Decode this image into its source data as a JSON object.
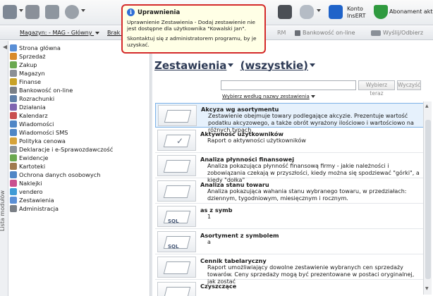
{
  "ribbon": {
    "konto_label": "Konto\nInsERT",
    "abonament_label": "Abonament aktyw"
  },
  "toolbar2": {
    "magazyn": "Magazyn: - MAG - Główny",
    "brak": "Brak b",
    "rm": "RM",
    "bankowosc": "Bankowość on-line",
    "wyslij": "Wyślij/Odbierz"
  },
  "tooltip": {
    "title": "Uprawnienia",
    "body": "Uprawnienie Zestawienia - Dodaj zestawienie nie jest dostępne dla użytkownika \"Kowalski Jan\".",
    "contact": "Skontaktuj się z administratorem programu, by je uzyskać."
  },
  "sidebar": {
    "tab_label": "Lista modułów",
    "items": [
      {
        "label": "Strona główna",
        "color": "#5a8fd6"
      },
      {
        "label": "Sprzedaż",
        "color": "#d98b2b"
      },
      {
        "label": "Zakup",
        "color": "#6aa84f"
      },
      {
        "label": "Magazyn",
        "color": "#8a8f96"
      },
      {
        "label": "Finanse",
        "color": "#c9a227"
      },
      {
        "label": "Bankowość on-line",
        "color": "#7a7f86"
      },
      {
        "label": "Rozrachunki",
        "color": "#5f7fa8"
      },
      {
        "label": "Działania",
        "color": "#7e64b0"
      },
      {
        "label": "Kalendarz",
        "color": "#c94f4f"
      },
      {
        "label": "Wiadomości",
        "color": "#4f86c6"
      },
      {
        "label": "Wiadomości SMS",
        "color": "#4f86c6"
      },
      {
        "label": "Polityka cenowa",
        "color": "#d6a33a"
      },
      {
        "label": "Deklaracje i e-Sprawozdawczość",
        "color": "#8b9299"
      },
      {
        "label": "Ewidencje",
        "color": "#6aa84f"
      },
      {
        "label": "Kartoteki",
        "color": "#a07a4f"
      },
      {
        "label": "Ochrona danych osobowych",
        "color": "#4f86c6"
      },
      {
        "label": "Naklejki",
        "color": "#c94f8f"
      },
      {
        "label": "vendero",
        "color": "#3f9bd6"
      },
      {
        "label": "Zestawienia",
        "color": "#5a8fd6"
      },
      {
        "label": "Administracja",
        "color": "#7a7f86"
      }
    ]
  },
  "main": {
    "title": "Zestawienia",
    "filter": "(wszystkie)",
    "search_value": "",
    "search_button": "Wybierz teraz",
    "clear_button": "Wyczyść",
    "sort_label": "Wybierz według nazwy zestawienia",
    "rows": [
      {
        "title": "Akcyza wg asortymentu",
        "desc": "Zestawienie obejmuje towary podlegające akcyzie. Prezentuje wartość podatku akcyzowego, a także obrót wyrażony ilościowo i wartościowo na różnych typach",
        "thumb": "card"
      },
      {
        "title": "Aktywność użytkowników",
        "desc": "Raport o aktywności użytkowników",
        "thumb": "check"
      },
      {
        "title": "Analiza płynności finansowej",
        "desc": "Analiza pokazująca płynność finansową firmy - jakie należności i zobowiązania czekają w przyszłości, kiedy można się spodziewać \"górki\", a kiedy \"dołka\"",
        "thumb": "card"
      },
      {
        "title": "Analiza stanu towaru",
        "desc": "Analiza pokazująca wahania stanu wybranego towaru, w przedziałach: dziennym, tygodniowym, miesięcznym i rocznym.",
        "thumb": "card"
      },
      {
        "title": "as z symb",
        "desc": "1",
        "thumb": "sql"
      },
      {
        "title": "Asortyment z symbolem",
        "desc": "a",
        "thumb": "sql"
      },
      {
        "title": "Cennik tabelaryczny",
        "desc": "Raport umożliwiający dowolne zestawienie wybranych cen sprzedaży towarów. Ceny sprzedaży mogą być prezentowane w postaci oryginalnej, jak zostać",
        "thumb": "card"
      },
      {
        "title": "Czyszczące",
        "desc": "",
        "thumb": "card"
      }
    ]
  }
}
